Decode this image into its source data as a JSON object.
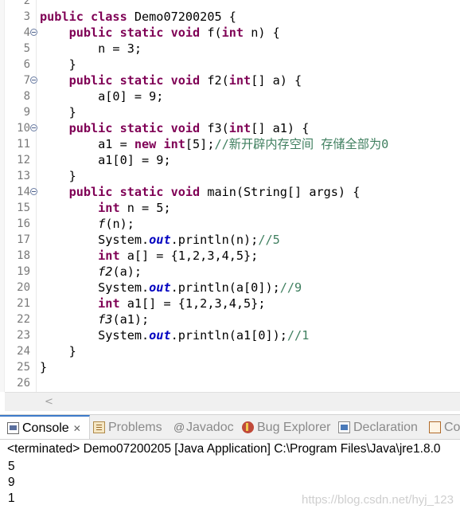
{
  "editor": {
    "lines": [
      {
        "n": "2",
        "fold": false,
        "tokens": []
      },
      {
        "n": "3",
        "fold": false,
        "tokens": [
          {
            "t": "public class",
            "c": "kw"
          },
          {
            "t": " Demo07200205 {",
            "c": ""
          }
        ]
      },
      {
        "n": "4",
        "fold": true,
        "tokens": [
          {
            "t": "    ",
            "c": ""
          },
          {
            "t": "public static void",
            "c": "kw"
          },
          {
            "t": " f(",
            "c": ""
          },
          {
            "t": "int",
            "c": "kw"
          },
          {
            "t": " n) {",
            "c": ""
          }
        ]
      },
      {
        "n": "5",
        "fold": false,
        "tokens": [
          {
            "t": "        n = 3;",
            "c": ""
          }
        ]
      },
      {
        "n": "6",
        "fold": false,
        "tokens": [
          {
            "t": "    }",
            "c": ""
          }
        ]
      },
      {
        "n": "7",
        "fold": true,
        "tokens": [
          {
            "t": "    ",
            "c": ""
          },
          {
            "t": "public static void",
            "c": "kw"
          },
          {
            "t": " f2(",
            "c": ""
          },
          {
            "t": "int",
            "c": "kw"
          },
          {
            "t": "[] a) {",
            "c": ""
          }
        ]
      },
      {
        "n": "8",
        "fold": false,
        "tokens": [
          {
            "t": "        a[0] = 9;",
            "c": ""
          }
        ]
      },
      {
        "n": "9",
        "fold": false,
        "tokens": [
          {
            "t": "    }",
            "c": ""
          }
        ]
      },
      {
        "n": "10",
        "fold": true,
        "tokens": [
          {
            "t": "    ",
            "c": ""
          },
          {
            "t": "public static void",
            "c": "kw"
          },
          {
            "t": " f3(",
            "c": ""
          },
          {
            "t": "int",
            "c": "kw"
          },
          {
            "t": "[] a1) {",
            "c": ""
          }
        ]
      },
      {
        "n": "11",
        "fold": false,
        "tokens": [
          {
            "t": "        a1 = ",
            "c": ""
          },
          {
            "t": "new int",
            "c": "kw"
          },
          {
            "t": "[5];",
            "c": ""
          },
          {
            "t": "//新开辟内存空间 存储全部为0",
            "c": "cm"
          }
        ]
      },
      {
        "n": "12",
        "fold": false,
        "tokens": [
          {
            "t": "        a1[0] = 9;",
            "c": ""
          }
        ]
      },
      {
        "n": "13",
        "fold": false,
        "tokens": [
          {
            "t": "    }",
            "c": ""
          }
        ]
      },
      {
        "n": "14",
        "fold": true,
        "tokens": [
          {
            "t": "    ",
            "c": ""
          },
          {
            "t": "public static void",
            "c": "kw"
          },
          {
            "t": " main(String[] args) {",
            "c": ""
          }
        ]
      },
      {
        "n": "15",
        "fold": false,
        "tokens": [
          {
            "t": "        ",
            "c": ""
          },
          {
            "t": "int",
            "c": "kw"
          },
          {
            "t": " n = 5;",
            "c": ""
          }
        ]
      },
      {
        "n": "16",
        "fold": false,
        "tokens": [
          {
            "t": "        ",
            "c": ""
          },
          {
            "t": "f",
            "c": "it"
          },
          {
            "t": "(n);",
            "c": ""
          }
        ]
      },
      {
        "n": "17",
        "fold": false,
        "tokens": [
          {
            "t": "        System.",
            "c": ""
          },
          {
            "t": "out",
            "c": "st"
          },
          {
            "t": ".println(n);",
            "c": ""
          },
          {
            "t": "//5",
            "c": "cm"
          }
        ]
      },
      {
        "n": "18",
        "fold": false,
        "tokens": [
          {
            "t": "        ",
            "c": ""
          },
          {
            "t": "int",
            "c": "kw"
          },
          {
            "t": " a[] = {1,2,3,4,5};",
            "c": ""
          }
        ]
      },
      {
        "n": "19",
        "fold": false,
        "tokens": [
          {
            "t": "        ",
            "c": ""
          },
          {
            "t": "f2",
            "c": "it"
          },
          {
            "t": "(a);",
            "c": ""
          }
        ]
      },
      {
        "n": "20",
        "fold": false,
        "tokens": [
          {
            "t": "        System.",
            "c": ""
          },
          {
            "t": "out",
            "c": "st"
          },
          {
            "t": ".println(a[0]);",
            "c": ""
          },
          {
            "t": "//9",
            "c": "cm"
          }
        ]
      },
      {
        "n": "21",
        "fold": false,
        "tokens": [
          {
            "t": "        ",
            "c": ""
          },
          {
            "t": "int",
            "c": "kw"
          },
          {
            "t": " a1[] = {1,2,3,4,5};",
            "c": ""
          }
        ]
      },
      {
        "n": "22",
        "fold": false,
        "tokens": [
          {
            "t": "        ",
            "c": ""
          },
          {
            "t": "f3",
            "c": "it"
          },
          {
            "t": "(a1);",
            "c": ""
          }
        ]
      },
      {
        "n": "23",
        "fold": false,
        "tokens": [
          {
            "t": "        System.",
            "c": ""
          },
          {
            "t": "out",
            "c": "st"
          },
          {
            "t": ".println(a1[0]);",
            "c": ""
          },
          {
            "t": "//1",
            "c": "cm"
          }
        ]
      },
      {
        "n": "24",
        "fold": false,
        "tokens": [
          {
            "t": "    }",
            "c": ""
          }
        ]
      },
      {
        "n": "25",
        "fold": false,
        "tokens": [
          {
            "t": "}",
            "c": ""
          }
        ]
      },
      {
        "n": "26",
        "fold": false,
        "tokens": []
      }
    ],
    "scroll_left_glyph": "<"
  },
  "tabs": [
    {
      "label": "Console",
      "icon": "console-icon",
      "active": true,
      "close": "✕"
    },
    {
      "label": "Problems",
      "icon": "problems-icon",
      "active": false
    },
    {
      "label": "Javadoc",
      "icon": "javadoc-icon",
      "glyph": "@",
      "active": false
    },
    {
      "label": "Bug Explorer",
      "icon": "bug-icon",
      "active": false
    },
    {
      "label": "Declaration",
      "icon": "declaration-icon",
      "active": false
    },
    {
      "label": "Co",
      "icon": "coverage-icon",
      "active": false
    }
  ],
  "console": {
    "terminated": "<terminated> Demo07200205 [Java Application] C:\\Program Files\\Java\\jre1.8.0",
    "output": [
      "5",
      "9",
      "1"
    ],
    "watermark": "https://blog.csdn.net/hyj_123"
  },
  "colors": {
    "keyword": "#7f0055",
    "comment": "#3f7f5f",
    "static_field": "#0000c0",
    "active_tab_accent": "#3d7ac9"
  }
}
